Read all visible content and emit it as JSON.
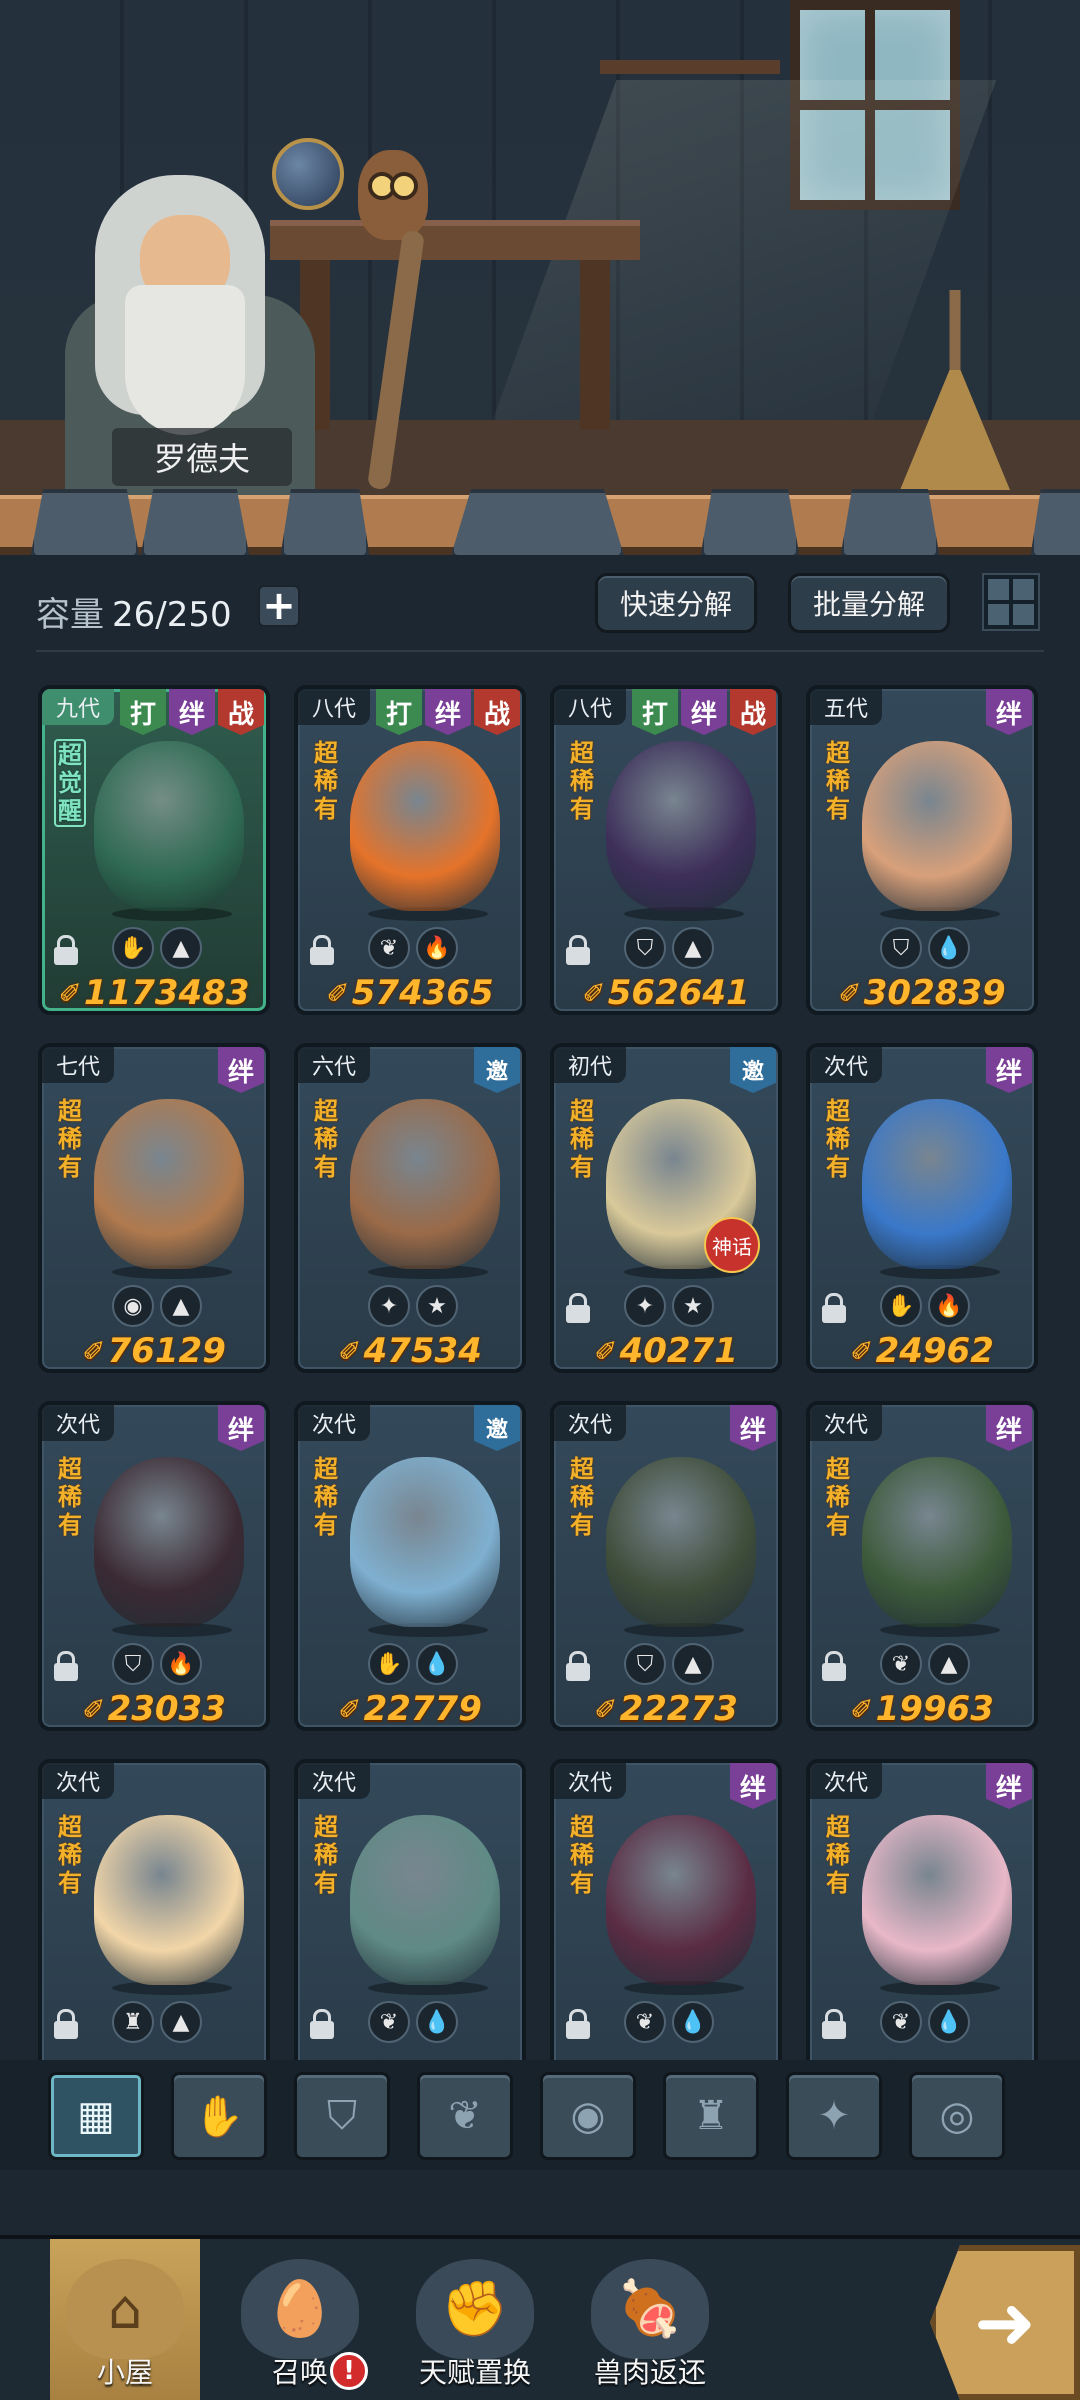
{
  "npc": {
    "name": "罗德夫"
  },
  "toolbar": {
    "capacity_label": "容量",
    "capacity_value": "26/250",
    "add_symbol": "+",
    "quick_decompose": "快速分解",
    "batch_decompose": "批量分解"
  },
  "cards": [
    {
      "gen": "九代",
      "tags": [
        "打",
        "绊",
        "战"
      ],
      "rarity": "超觉醒",
      "awakened": true,
      "attrs": [
        "claw",
        "horn"
      ],
      "power": "1173483",
      "locked": true,
      "creature_color": "#2f6a54"
    },
    {
      "gen": "八代",
      "tags": [
        "打",
        "绊",
        "战"
      ],
      "rarity": "超稀有",
      "attrs": [
        "sprout",
        "fire"
      ],
      "power": "574365",
      "locked": true,
      "creature_color": "#e5732a"
    },
    {
      "gen": "八代",
      "tags": [
        "打",
        "绊",
        "战"
      ],
      "rarity": "超稀有",
      "attrs": [
        "shield",
        "horn"
      ],
      "power": "562641",
      "locked": true,
      "creature_color": "#3d2f5a"
    },
    {
      "gen": "五代",
      "tags": [
        "绊"
      ],
      "rarity": "超稀有",
      "attrs": [
        "shield",
        "water"
      ],
      "power": "302839",
      "locked": false,
      "creature_color": "#d8a07a"
    },
    {
      "gen": "七代",
      "tags": [
        "绊"
      ],
      "rarity": "超稀有",
      "attrs": [
        "egg",
        "horn"
      ],
      "power": "76129",
      "locked": false,
      "creature_color": "#b07a4e"
    },
    {
      "gen": "六代",
      "tags": [
        "邀"
      ],
      "rarity": "超稀有",
      "attrs": [
        "star4",
        "star5"
      ],
      "power": "47534",
      "locked": false,
      "creature_color": "#9a6a48"
    },
    {
      "gen": "初代",
      "tags": [
        "邀"
      ],
      "rarity": "超稀有",
      "attrs": [
        "star4",
        "star5"
      ],
      "power": "40271",
      "locked": true,
      "creature_color": "#d9c99a",
      "myth": "神话"
    },
    {
      "gen": "次代",
      "tags": [
        "绊"
      ],
      "rarity": "超稀有",
      "attrs": [
        "claw",
        "fire"
      ],
      "power": "24962",
      "locked": true,
      "creature_color": "#3a78c9"
    },
    {
      "gen": "次代",
      "tags": [
        "绊"
      ],
      "rarity": "超稀有",
      "attrs": [
        "shield",
        "fire"
      ],
      "power": "23033",
      "locked": true,
      "creature_color": "#3b2a33"
    },
    {
      "gen": "次代",
      "tags": [
        "邀"
      ],
      "rarity": "超稀有",
      "attrs": [
        "claw",
        "water"
      ],
      "power": "22779",
      "locked": false,
      "creature_color": "#7fb0d0"
    },
    {
      "gen": "次代",
      "tags": [
        "绊"
      ],
      "rarity": "超稀有",
      "attrs": [
        "shield",
        "horn"
      ],
      "power": "22273",
      "locked": true,
      "creature_color": "#3f4d3a"
    },
    {
      "gen": "次代",
      "tags": [
        "绊"
      ],
      "rarity": "超稀有",
      "attrs": [
        "sprout",
        "horn"
      ],
      "power": "19963",
      "locked": true,
      "creature_color": "#3c5a3a"
    },
    {
      "gen": "次代",
      "tags": [],
      "rarity": "超稀有",
      "attrs": [
        "tower",
        "horn"
      ],
      "power": "",
      "locked": true,
      "creature_color": "#f2d6a8"
    },
    {
      "gen": "次代",
      "tags": [],
      "rarity": "超稀有",
      "attrs": [
        "sprout",
        "water"
      ],
      "power": "",
      "locked": true,
      "creature_color": "#5f8a85"
    },
    {
      "gen": "次代",
      "tags": [
        "绊"
      ],
      "rarity": "超稀有",
      "attrs": [
        "sprout",
        "water"
      ],
      "power": "",
      "locked": true,
      "creature_color": "#5a2c44"
    },
    {
      "gen": "次代",
      "tags": [
        "绊"
      ],
      "rarity": "超稀有",
      "attrs": [
        "sprout",
        "water"
      ],
      "power": "",
      "locked": true,
      "creature_color": "#e8b8c8"
    }
  ],
  "filters": [
    "all-icon",
    "claw-icon",
    "shield-icon",
    "sprout-icon",
    "egg-icon",
    "tower-icon",
    "compass-icon",
    "swirl-icon"
  ],
  "nav": {
    "hut": "小屋",
    "summon": "召唤",
    "talent_swap": "天赋置换",
    "meat_return": "兽肉返还",
    "summon_badge": "!"
  },
  "colors": {
    "power_gold": "#ffb52c",
    "rarity_orange": "#f3b12a",
    "tag_green": "#3c8a50",
    "tag_purple": "#7a3f96",
    "tag_red": "#b3392f",
    "tag_blue": "#2f6d9a"
  }
}
